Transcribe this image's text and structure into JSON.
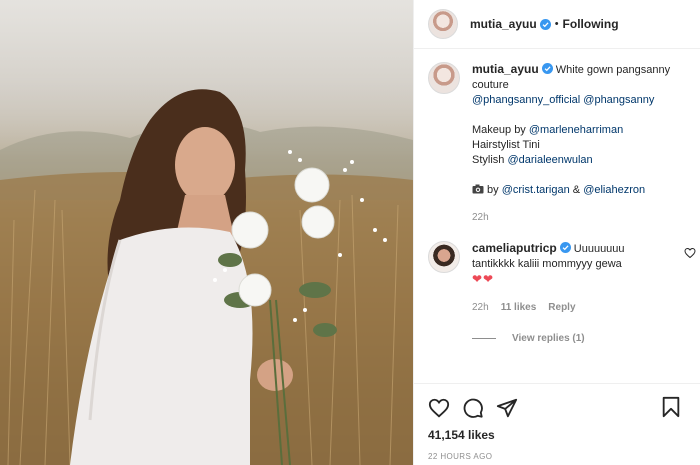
{
  "post": {
    "photo_alt": "",
    "author": "mutia_ayuu",
    "separator": "•",
    "follow_state": "Following"
  },
  "caption": {
    "username": "mutia_ayuu",
    "line1": "White gown pangsanny",
    "line2": "couture",
    "tag1": "@phangsanny_official",
    "tag2": "@phangsanny",
    "makeup_prefix": "Makeup by",
    "makeup_tag": "@marleneharriman",
    "hair": "Hairstylist Tini",
    "stylish_prefix": "Stylish",
    "stylish_tag": "@darialeenwulan",
    "photo_prefix": "by",
    "photo_tag1": "@crist.tarigan",
    "photo_and": "&",
    "photo_tag2": "@eliahezron",
    "time": "22h"
  },
  "comment": {
    "username": "cameliaputricp",
    "text": "Uuuuuuuu tantikkkk kaliii mommyyy gewa",
    "hearts": "❤❤",
    "time": "22h",
    "likes": "11 likes",
    "reply": "Reply",
    "view_replies": "View replies (1)"
  },
  "footer": {
    "likes": "41,154 likes",
    "posted": "22 HOURS AGO"
  },
  "colors": {
    "verified": "#3897f0",
    "link": "#00376b",
    "heart": "#ed4956",
    "muted": "#8e8e8e"
  },
  "icons": {
    "like": "heart-outline",
    "comment": "speech-bubble",
    "share": "paper-plane",
    "save": "bookmark"
  }
}
